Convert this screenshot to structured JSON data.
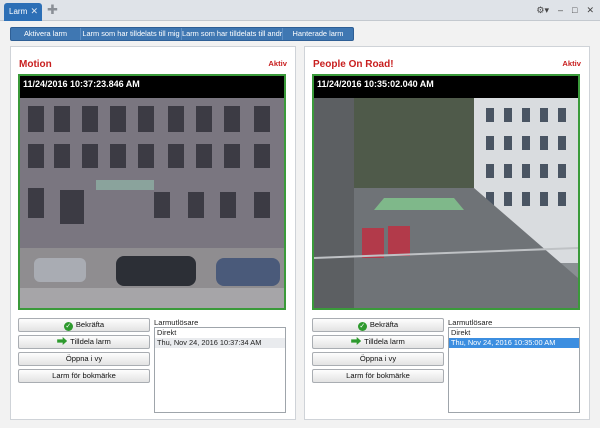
{
  "tab": {
    "label": "Larm",
    "close": "✕",
    "add": "✚"
  },
  "window": {
    "gear": "⚙▾",
    "minimize": "–",
    "maximize": "□",
    "close": "✕"
  },
  "toolbar": [
    {
      "label": "Aktivera larm"
    },
    {
      "label": "Larm som har tilldelats till mig"
    },
    {
      "label": "Larm som har tilldelats till andra"
    },
    {
      "label": "Hanterade larm"
    }
  ],
  "panels": [
    {
      "title": "Motion",
      "status": "Aktiv",
      "timestamp": "11/24/2016 10:37:23.846 AM",
      "actions": {
        "confirm": "Bekräfta",
        "assign": "Tilldela larm",
        "open": "Öppna i vy",
        "bookmark": "Larm för bokmärke"
      },
      "triggers_label": "Larmutlösare",
      "triggers": [
        {
          "text": "Direkt",
          "state": "normal"
        },
        {
          "text": "Thu, Nov 24, 2016 10:37:34 AM",
          "state": "grey"
        }
      ]
    },
    {
      "title": "People On Road!",
      "status": "Aktiv",
      "timestamp": "11/24/2016 10:35:02.040 AM",
      "actions": {
        "confirm": "Bekräfta",
        "assign": "Tilldela larm",
        "open": "Öppna i vy",
        "bookmark": "Larm för bokmärke"
      },
      "triggers_label": "Larmutlösare",
      "triggers": [
        {
          "text": "Direkt",
          "state": "normal"
        },
        {
          "text": "Thu, Nov 24, 2016 10:35:00 AM",
          "state": "selected"
        }
      ]
    }
  ],
  "colors": {
    "accent": "#2c6fb6",
    "alarm_red": "#c81e1e",
    "frame_green": "#3a9a3a",
    "selection": "#3c8ee0"
  }
}
